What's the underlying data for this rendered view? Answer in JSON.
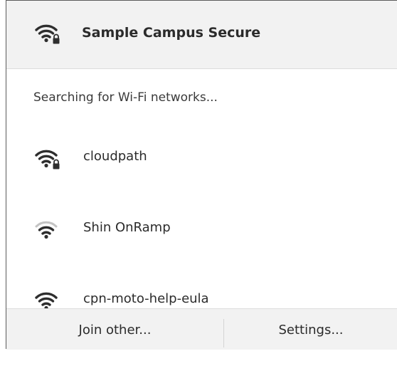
{
  "connected_network": {
    "name": "Sample Campus Secure",
    "icon": "wifi-lock-icon"
  },
  "status_text": "Searching for Wi-Fi networks...",
  "networks": [
    {
      "name": "cloudpath",
      "icon": "wifi-lock-icon",
      "secured": true
    },
    {
      "name": "Shin OnRamp",
      "icon": "wifi-icon",
      "secured": false
    },
    {
      "name": "cpn-moto-help-eula",
      "icon": "wifi-icon",
      "secured": false
    }
  ],
  "footer": {
    "join_other_label": "Join other...",
    "settings_label": "Settings..."
  },
  "colors": {
    "header_bg": "#f2f2f2",
    "icon": "#2e2e2e",
    "icon_weak": "#bdbdbd",
    "text": "#2b2b2b"
  }
}
